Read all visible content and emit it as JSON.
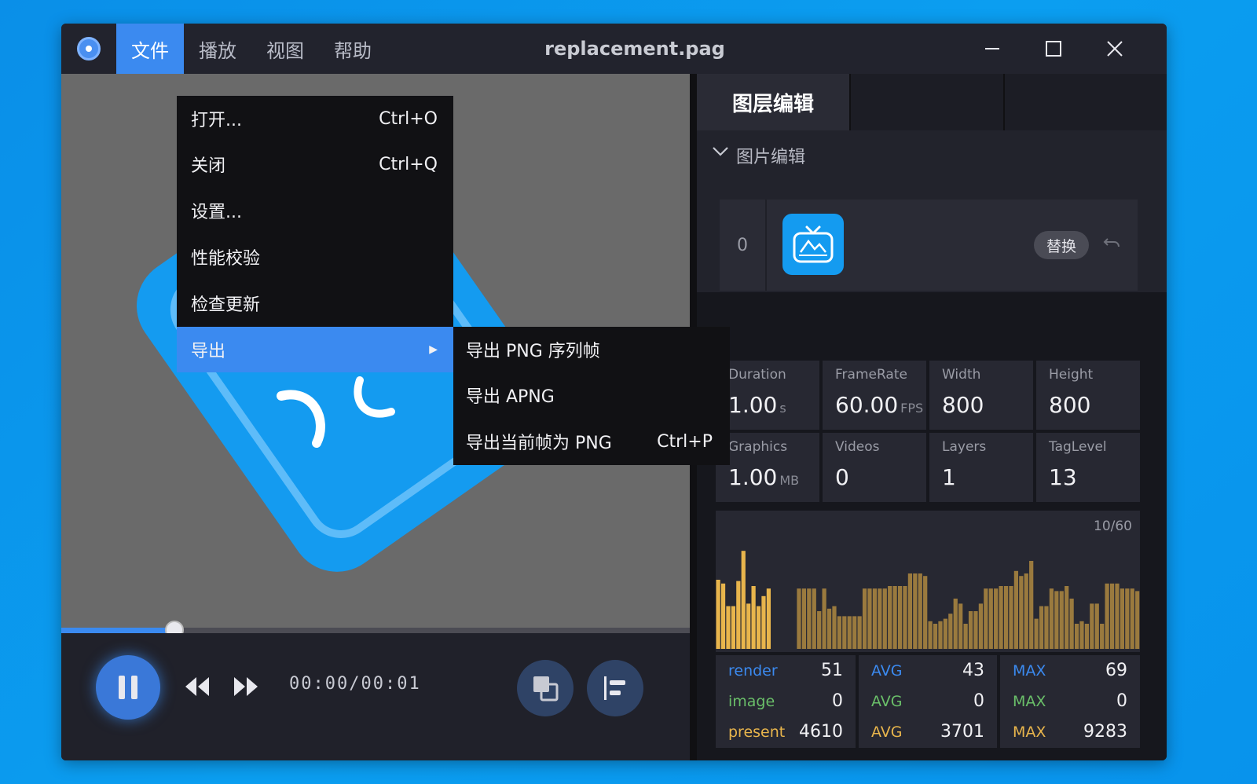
{
  "window": {
    "title": "replacement.pag",
    "menu": [
      "文件",
      "播放",
      "视图",
      "帮助"
    ]
  },
  "file_menu": {
    "items": [
      {
        "label": "打开...",
        "shortcut": "Ctrl+O"
      },
      {
        "label": "关闭",
        "shortcut": "Ctrl+Q"
      },
      {
        "label": "设置...",
        "shortcut": ""
      },
      {
        "label": "性能校验",
        "shortcut": ""
      },
      {
        "label": "检查更新",
        "shortcut": ""
      },
      {
        "label": "导出",
        "shortcut": ""
      }
    ],
    "export_submenu": [
      {
        "label": "导出 PNG 序列帧",
        "shortcut": ""
      },
      {
        "label": "导出 APNG",
        "shortcut": ""
      },
      {
        "label": "导出当前帧为 PNG",
        "shortcut": "Ctrl+P"
      }
    ]
  },
  "player": {
    "time": "00:00/00:01",
    "progress": 0.18
  },
  "panel": {
    "tab_active": "图层编辑",
    "section_title": "图片编辑",
    "image_index": "0",
    "replace_label": "替换"
  },
  "stats": [
    {
      "label": "Duration",
      "value": "1.00",
      "unit": "s"
    },
    {
      "label": "FrameRate",
      "value": "60.00",
      "unit": "FPS"
    },
    {
      "label": "Width",
      "value": "800",
      "unit": ""
    },
    {
      "label": "Height",
      "value": "800",
      "unit": ""
    },
    {
      "label": "Graphics",
      "value": "1.00",
      "unit": "MB"
    },
    {
      "label": "Videos",
      "value": "0",
      "unit": ""
    },
    {
      "label": "Layers",
      "value": "1",
      "unit": ""
    },
    {
      "label": "TagLevel",
      "value": "13",
      "unit": ""
    }
  ],
  "graph": {
    "frame_label": "10/60",
    "bars": [
      0.55,
      0.52,
      0.34,
      0.34,
      0.54,
      0.78,
      0.36,
      0.5,
      0.34,
      0.42,
      0.48,
      0,
      0,
      0,
      0,
      0,
      0.48,
      0.48,
      0.48,
      0.48,
      0.3,
      0.48,
      0.32,
      0.34,
      0.26,
      0.26,
      0.26,
      0.26,
      0.26,
      0.48,
      0.48,
      0.48,
      0.48,
      0.48,
      0.5,
      0.5,
      0.5,
      0.5,
      0.6,
      0.6,
      0.6,
      0.58,
      0.22,
      0.2,
      0.22,
      0.24,
      0.28,
      0.4,
      0.36,
      0.2,
      0.3,
      0.3,
      0.36,
      0.48,
      0.48,
      0.48,
      0.5,
      0.5,
      0.5,
      0.62,
      0.58,
      0.6,
      0.7,
      0.24,
      0.34,
      0.34,
      0.48,
      0.46,
      0.46,
      0.5,
      0.4,
      0.2,
      0.22,
      0.2,
      0.36,
      0.36,
      0.2,
      0.52,
      0.52,
      0.52,
      0.48,
      0.48,
      0.48,
      0.46
    ],
    "bright_bars": 11
  },
  "perf": [
    {
      "name": "render",
      "value": "51",
      "avg_label": "AVG",
      "avg": "43",
      "max_label": "MAX",
      "max": "69",
      "color": "#3b8af0"
    },
    {
      "name": "image",
      "value": "0",
      "avg_label": "AVG",
      "avg": "0",
      "max_label": "MAX",
      "max": "0",
      "color": "#6abf69"
    },
    {
      "name": "present",
      "value": "4610",
      "avg_label": "AVG",
      "avg": "3701",
      "max_label": "MAX",
      "max": "9283",
      "color": "#e8b54c"
    }
  ],
  "colors": {
    "accent": "#3b8af0",
    "bar_bright": "#e8b54c",
    "bar_dim": "#9a7a3e"
  }
}
